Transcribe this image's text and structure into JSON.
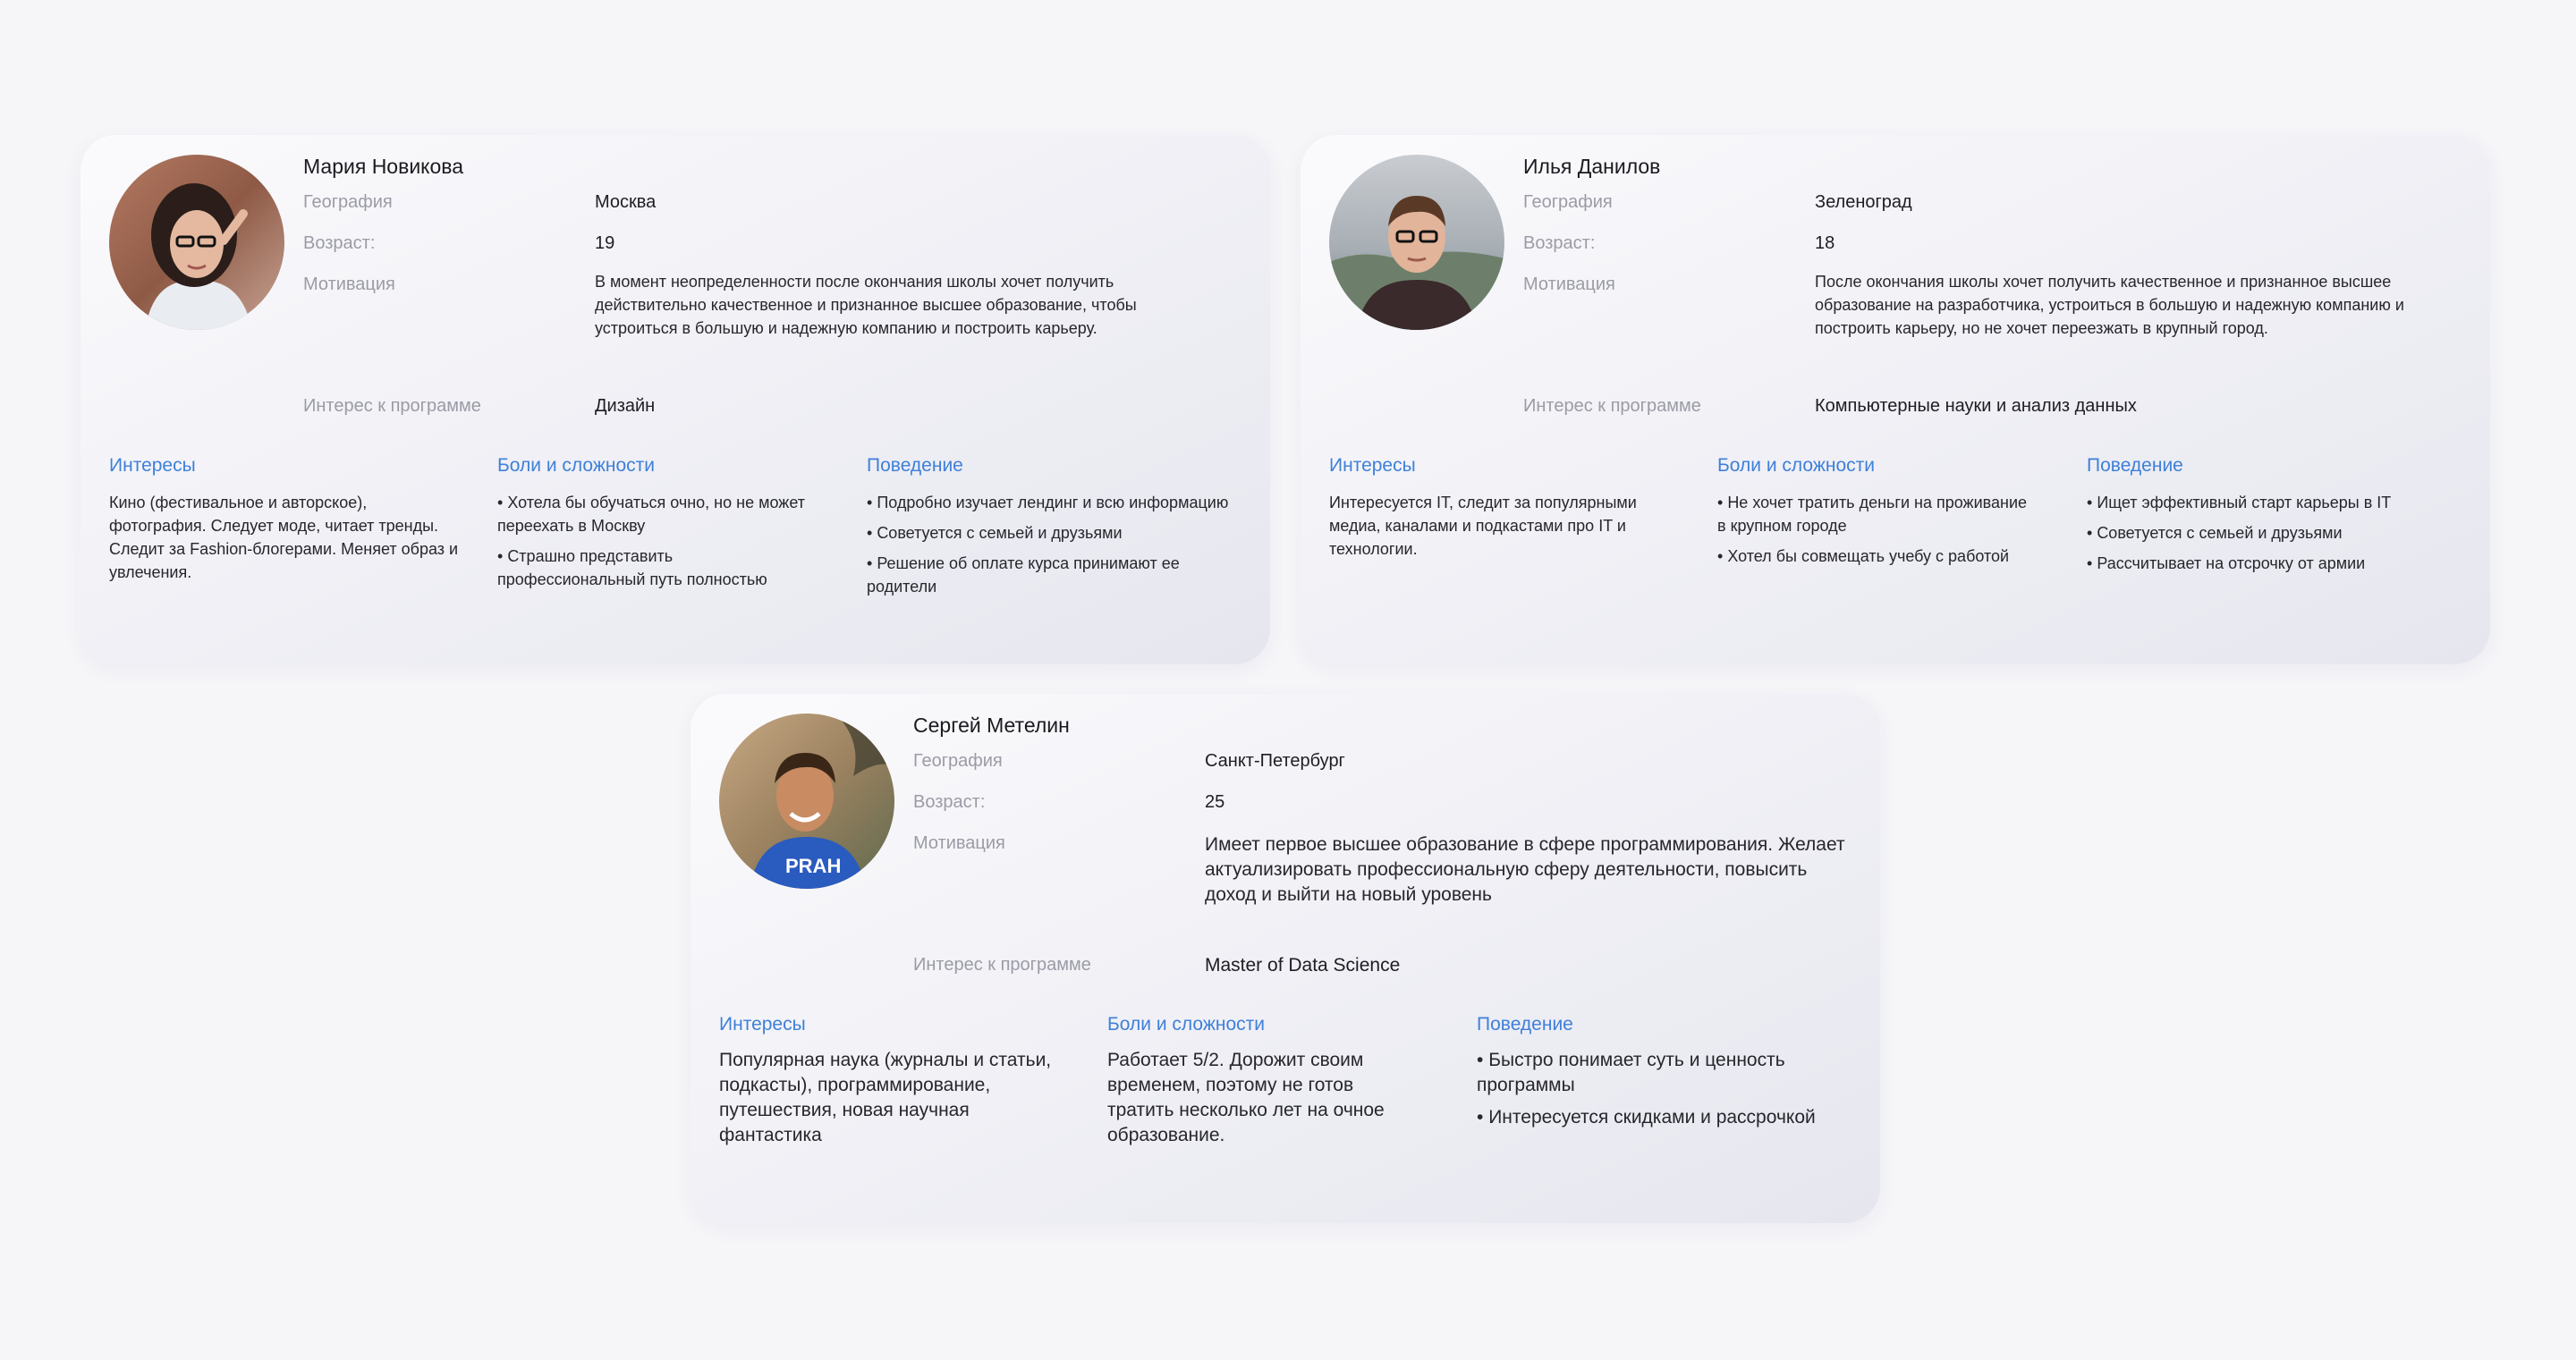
{
  "personas": [
    {
      "name": "Мария Новикова",
      "geography_label": "География",
      "geography": "Москва",
      "age_label": "Возраст:",
      "age": "19",
      "motivation_label": "Мотивация",
      "motivation": "В момент неопределенности после окончания школы хочет получить действительно качественное и признанное высшее образование, чтобы устроиться в большую и надежную компанию и построить карьеру.",
      "interest_label": "Интерес к программе",
      "interest": "Дизайн",
      "interests_title": "Интересы",
      "interests_text": "Кино (фестивальное и авторское), фотография. Следует моде, читает тренды. Следит за Fashion-блогерами. Меняет образ и увлечения.",
      "pains_title": "Боли и сложности",
      "pains": [
        "Хотела бы обучаться очно, но не может переехать в Москву",
        "Страшно представить профессиональный путь полностью"
      ],
      "behavior_title": "Поведение",
      "behavior": [
        "Подробно изучает лендинг и всю информацию",
        "Советуется с семьей и друзьями",
        "Решение об оплате курса принимают ее родители"
      ]
    },
    {
      "name": "Илья Данилов",
      "geography_label": "География",
      "geography": "Зеленоград",
      "age_label": "Возраст:",
      "age": "18",
      "motivation_label": "Мотивация",
      "motivation": "После окончания школы хочет получить качественное и признанное высшее образование на разработчика, устроиться в большую и надежную компанию и построить карьеру, но не хочет переезжать в крупный город.",
      "interest_label": "Интерес к программе",
      "interest": "Компьютерные науки и анализ данных",
      "interests_title": "Интересы",
      "interests_text": "Интересуется IT, следит за популярными медиа, каналами и подкастами про IT и технологии.",
      "pains_title": "Боли и сложности",
      "pains": [
        "Не хочет тратить деньги на проживание в крупном городе",
        "Хотел бы совмещать учебу с работой"
      ],
      "behavior_title": "Поведение",
      "behavior": [
        "Ищет эффективный старт карьеры в IT",
        "Советуется с семьей и друзьями",
        "Рассчитывает на отсрочку от армии"
      ]
    },
    {
      "name": "Сергей Метелин",
      "geography_label": "География",
      "geography": "Санкт-Петербург",
      "age_label": "Возраст:",
      "age": "25",
      "motivation_label": "Мотивация",
      "motivation": "Имеет первое высшее образование в сфере программирования. Желает актуализировать профессиональную сферу деятельности, повысить доход и выйти на новый уровень",
      "interest_label": "Интерес к программе",
      "interest": "Master of Data Science",
      "interests_title": "Интересы",
      "interests_text": "Популярная наука (журналы и статьи, подкасты), программирование, путешествия, новая научная фантастика",
      "pains_title": "Боли и сложности",
      "pains_text": "Работает 5/2. Дорожит своим временем, поэтому не готов тратить несколько лет на очное образование.",
      "behavior_title": "Поведение",
      "behavior": [
        "Быстро понимает суть и ценность программы",
        "Интересуется скидками и рассрочкой"
      ]
    }
  ]
}
